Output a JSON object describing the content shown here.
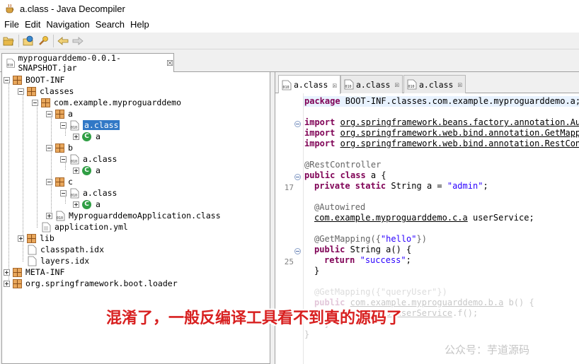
{
  "window": {
    "title": "a.class - Java Decompiler",
    "icon": "coffee-cup-icon"
  },
  "menu": [
    "File",
    "Edit",
    "Navigation",
    "Search",
    "Help"
  ],
  "toolbar": {
    "icons": [
      "open-file-icon",
      "open-type-icon",
      "search-icon",
      "back-arrow-icon",
      "forward-arrow-icon"
    ]
  },
  "jar_tab": {
    "label": "myproguarddemo-0.0.1-SNAPSHOT.jar",
    "close": "☒"
  },
  "tree": {
    "nodes": [
      "BOOT-INF",
      "classes",
      "com.example.myproguarddemo",
      "a",
      "a.class",
      "a",
      "b",
      "a.class",
      "a",
      "c",
      "a.class",
      "a",
      "MyproguarddemoApplication.class",
      "application.yml",
      "lib",
      "classpath.idx",
      "layers.idx",
      "META-INF",
      "org.springframework.boot.loader"
    ],
    "class_badge": "C",
    "file_badge": "010"
  },
  "editor": {
    "tabs": [
      "a.class",
      "a.class",
      "a.class"
    ],
    "close": "☒",
    "line_numbers": [
      "17",
      "25"
    ],
    "code": {
      "l1_kw": "package",
      "l1_rest": " BOOT-INF.classes.com.example.myproguarddemo.a;",
      "import_kw": "import",
      "imp1": "org.springframework.beans.factory.annotation.Autowired",
      "imp2": "org.springframework.web.bind.annotation.GetMapping",
      "imp3": "org.springframework.web.bind.annotation.RestController",
      "semi": ";",
      "ann_rc": "@RestController",
      "cls_kw": "public class",
      "cls_rest": " a {",
      "f_kw": "private static",
      "f_mid": " String a = ",
      "f_str": "\"admin\"",
      "f_end": ";",
      "ann_aw": "@Autowired",
      "svc_type": "com.example.myproguarddemo.c.a",
      "svc_rest": " userService;",
      "ann_gm": "@GetMapping({",
      "gm_str": "\"hello\"",
      "gm_end": "})",
      "m_kw": "public",
      "m_rest": " String a() {",
      "r_kw": "return",
      "r_str": "\"success\"",
      "r_end": ";",
      "close_brace": "}",
      "f1": "@GetMapping({\"queryUser\"})",
      "f2_kw": "public",
      "f2_type": "com.example.myproguarddemo.b.a",
      "f2_rest": " b() {",
      "f3_pre": "    return ",
      "f3_link": "this.userService",
      "f3_rest": ".f();",
      "f4": "  }",
      "f5": "}"
    }
  },
  "overlay": {
    "caption": "混淆了，一般反编译工具看不到真的源码了",
    "watermark": "公众号：芋道源码"
  }
}
